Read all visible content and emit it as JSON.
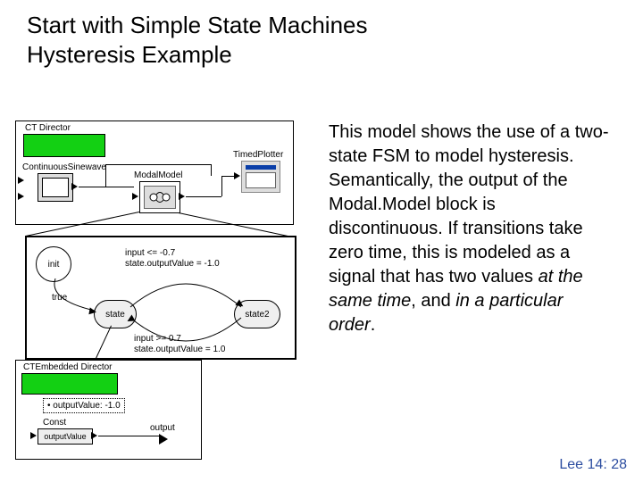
{
  "title_line1": "Start with Simple State Machines",
  "title_line2": "Hysteresis Example",
  "description": {
    "p1": "This model shows the use of a two-state FSM to model hysteresis. Semantically, the output of the Modal.Model block is discontinuous. If transitions take zero time, this is modeled as a signal that has two values ",
    "ital1": "at the same time",
    "p2": ", and ",
    "ital2": "in a particular order",
    "p3": "."
  },
  "footer": "Lee 14: 28",
  "top_panel": {
    "director_label": "CT Director",
    "sine_label": "ContinuousSinewave",
    "modal_label": "ModalModel",
    "plotter_label": "TimedPlotter"
  },
  "mid_panel": {
    "init_state": "init",
    "state1": "state",
    "state2": "state2",
    "guard1_a": "input <= -0.7",
    "guard1_b": "state.outputValue = -1.0",
    "guard2_a": "input >= 0.7",
    "guard2_b": "state.outputValue = 1.0",
    "true_label": "true"
  },
  "bot_panel": {
    "director_label": "CTEmbedded Director",
    "param_label": "outputValue: -1.0",
    "const_label": "Const",
    "outval_label": "outputValue",
    "output_label": "output"
  }
}
